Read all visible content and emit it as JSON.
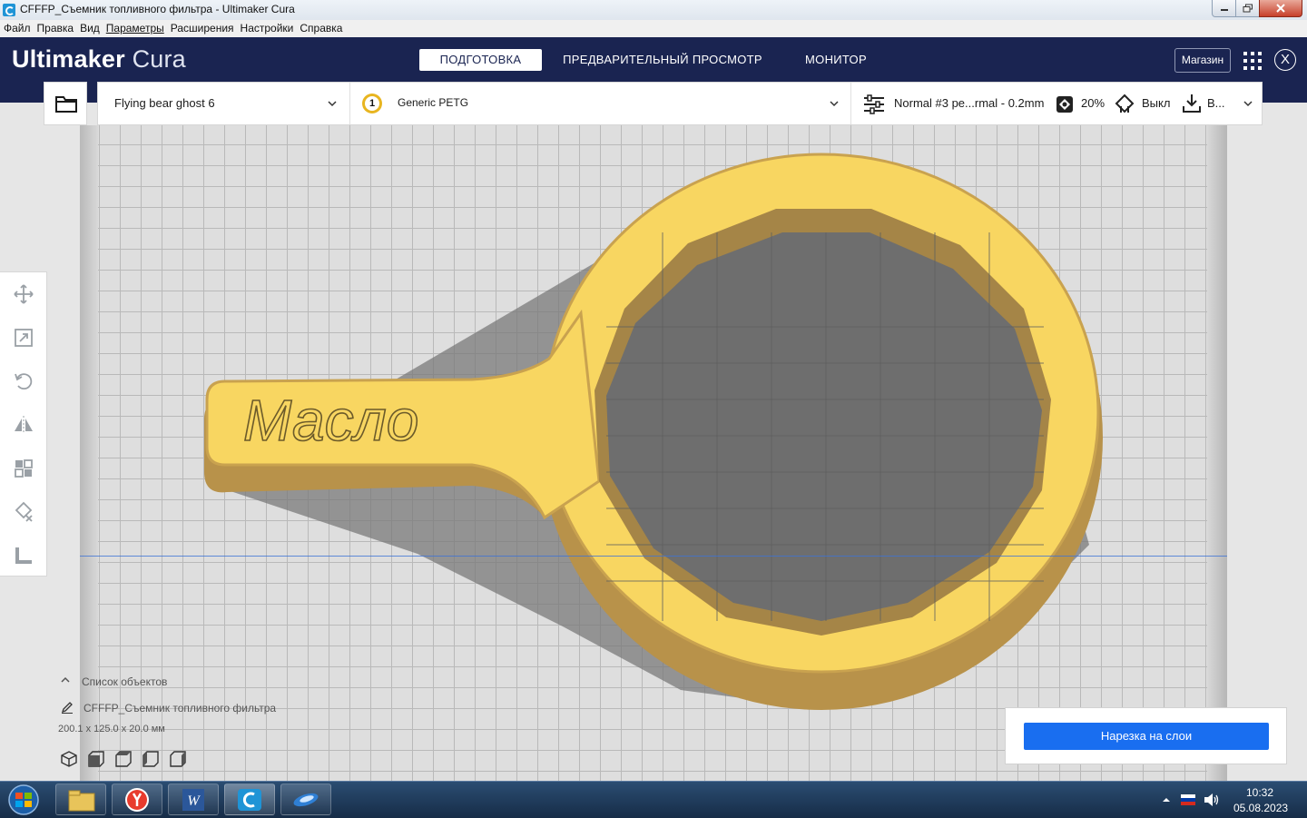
{
  "window": {
    "title": "CFFFP_Съемник топливного фильтра - Ultimaker Cura"
  },
  "menu": [
    "Файл",
    "Правка",
    "Вид",
    "Параметры",
    "Расширения",
    "Настройки",
    "Справка"
  ],
  "header": {
    "logo_bold": "Ultimaker",
    "logo_light": "Cura",
    "tabs": [
      {
        "label": "ПОДГОТОВКА",
        "active": true
      },
      {
        "label": "ПРЕДВАРИТЕЛЬНЫЙ ПРОСМОТР",
        "active": false
      },
      {
        "label": "МОНИТОР",
        "active": false
      }
    ],
    "marketplace": "Магазин"
  },
  "toolbar": {
    "printer": "Flying bear ghost 6",
    "extruder_number": "1",
    "material": "Generic PETG",
    "profile": "Normal #3 pe...rmal - 0.2mm",
    "infill": "20%",
    "support": "Выкл",
    "adhesion": "В..."
  },
  "model": {
    "label_text": "Масло",
    "color": "#f8d661"
  },
  "objects": {
    "header": "Список объектов",
    "name": "CFFFP_Съемник топливного фильтра",
    "dimensions": "200.1 x 125.0 x 20.0 мм"
  },
  "slice": {
    "button_label": "Нарезка на слои",
    "accent": "#196ef0"
  },
  "taskbar": {
    "time": "10:32",
    "date": "05.08.2023"
  }
}
